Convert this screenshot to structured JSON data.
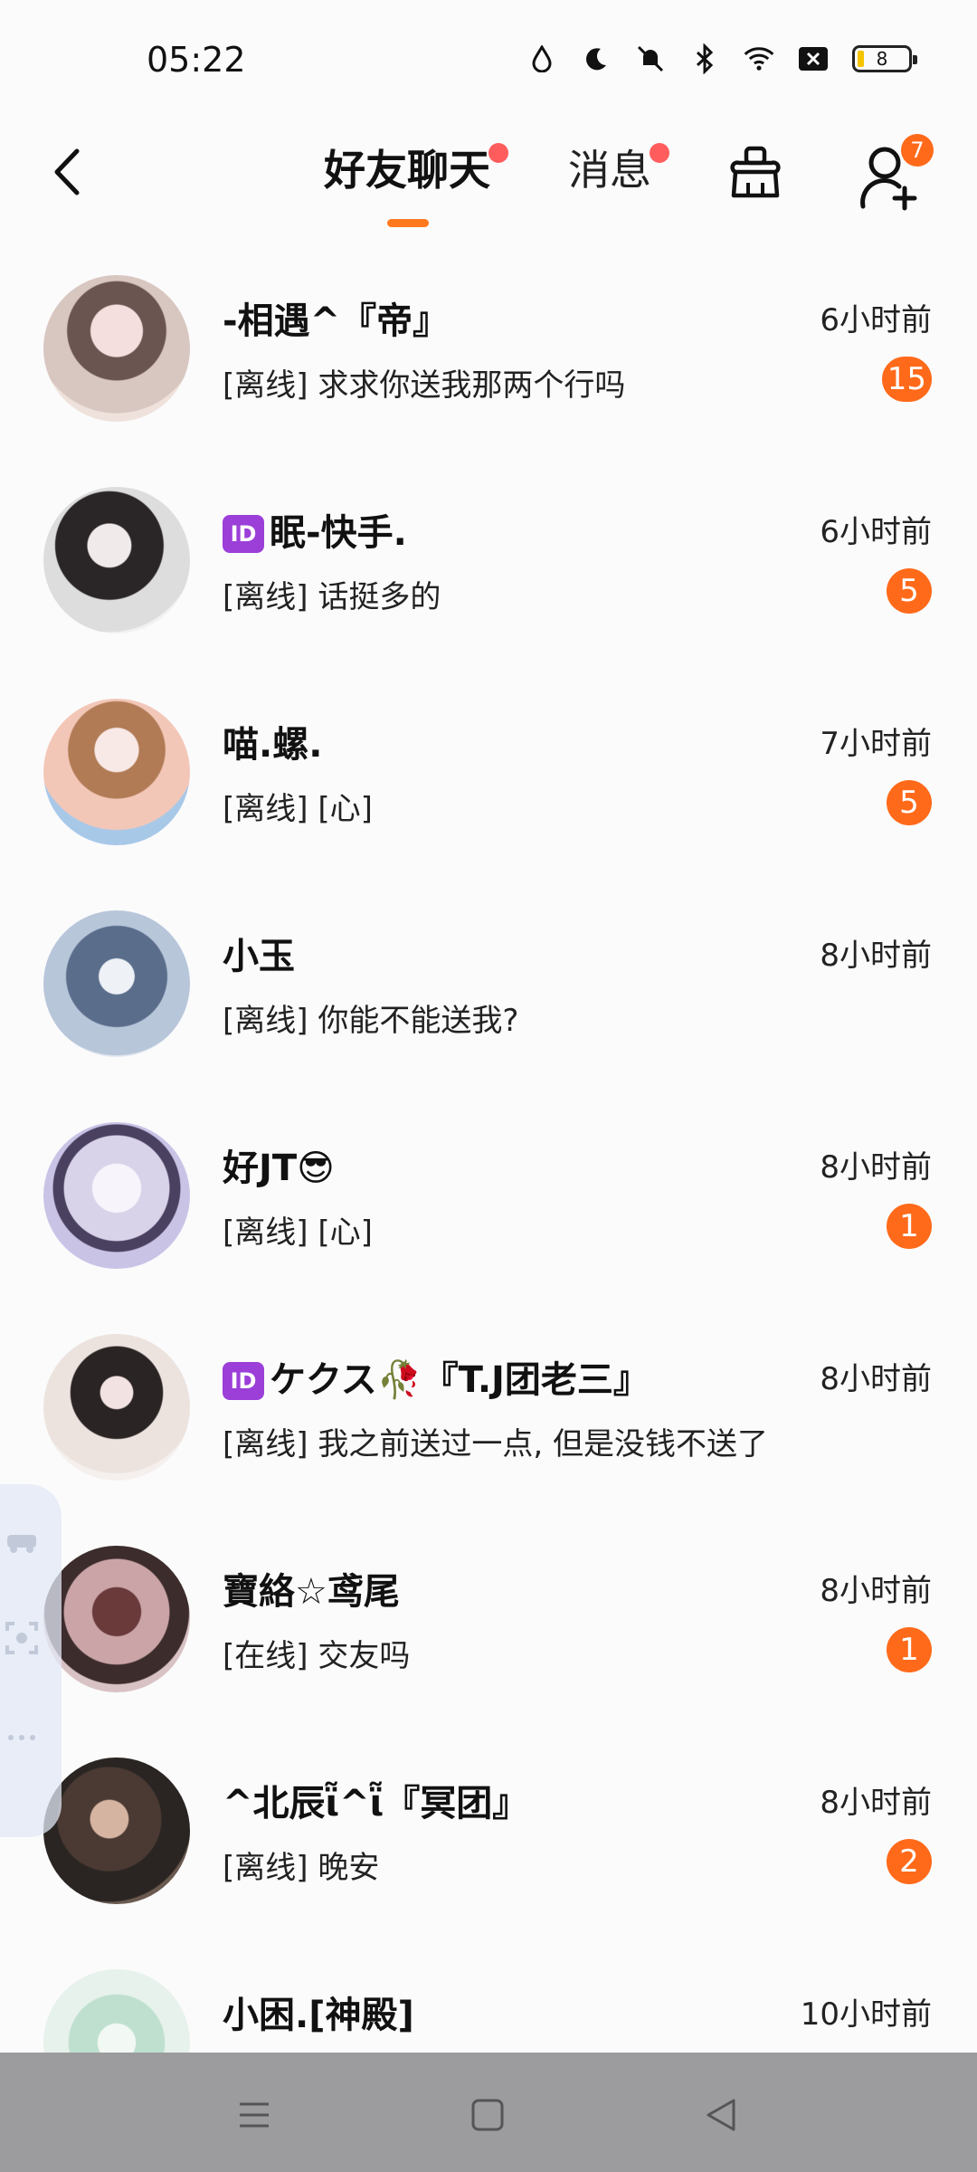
{
  "status_bar": {
    "time": "05:22",
    "battery": "8",
    "icons": [
      "drop-icon",
      "moon-icon",
      "mute-icon",
      "bluetooth-icon",
      "wifi-icon",
      "sim-off-icon",
      "battery-icon"
    ]
  },
  "header": {
    "tabs": [
      {
        "label": "好友聊天",
        "active": true,
        "has_dot": true
      },
      {
        "label": "消息",
        "active": false,
        "has_dot": true
      }
    ],
    "add_friend_badge": "7",
    "accent_color": "#ff7a1f"
  },
  "chats": [
    {
      "name": "-相遇^『帝』",
      "id_badge": false,
      "time": "6小时前",
      "preview": "[离线] 求求你送我那两个行吗",
      "unread": "15"
    },
    {
      "name": "眠-快手.",
      "id_badge": true,
      "time": "6小时前",
      "preview": "[离线] 话挺多的",
      "unread": "5"
    },
    {
      "name": "喵.螺.",
      "id_badge": false,
      "time": "7小时前",
      "preview": "[离线] [心]",
      "unread": "5"
    },
    {
      "name": "小玉",
      "id_badge": false,
      "time": "8小时前",
      "preview": "[离线] 你能不能送我?",
      "unread": ""
    },
    {
      "name": "好JT😎",
      "id_badge": false,
      "time": "8小时前",
      "preview": "[离线] [心]",
      "unread": "1"
    },
    {
      "name": "ケクス🥀『T.J团老三』",
      "id_badge": true,
      "time": "8小时前",
      "preview": "[离线] 我之前送过一点, 但是没钱不送了",
      "unread": ""
    },
    {
      "name": "寶絡☆鸢尾",
      "id_badge": false,
      "time": "8小时前",
      "preview": "[在线] 交友吗",
      "unread": "1"
    },
    {
      "name": "^北辰ῗ^ῗ『冥团』",
      "id_badge": false,
      "time": "8小时前",
      "preview": "[离线] 晚安",
      "unread": "2"
    },
    {
      "name": "小困.[神殿]",
      "id_badge": false,
      "time": "10小时前",
      "preview": "",
      "unread": ""
    }
  ],
  "id_badge_label": "ID"
}
